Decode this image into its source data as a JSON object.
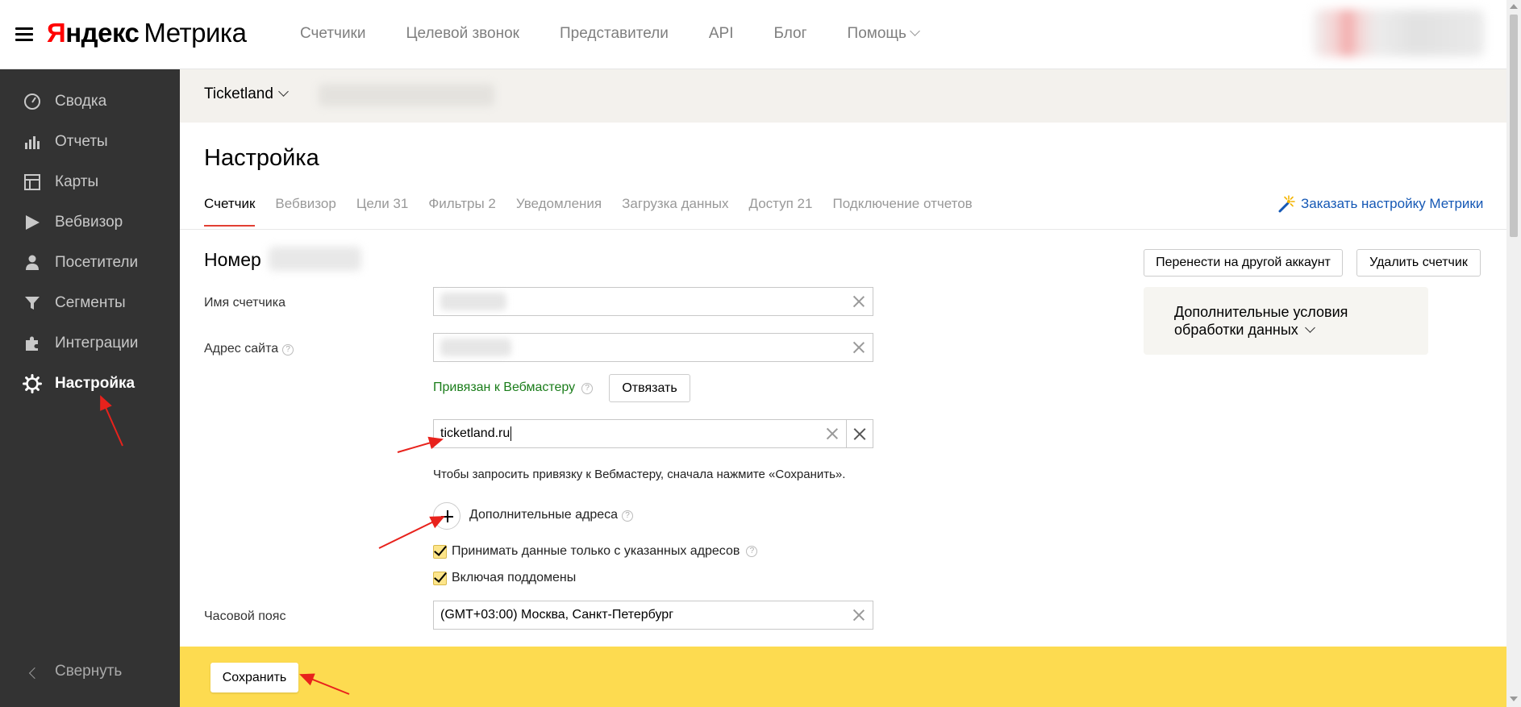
{
  "brand": {
    "logo_ya": "Я",
    "logo_ya_rest": "ндекс",
    "product": "Метрика"
  },
  "topnav": {
    "items": [
      {
        "label": "Счетчики"
      },
      {
        "label": "Целевой звонок"
      },
      {
        "label": "Представители"
      },
      {
        "label": "API"
      },
      {
        "label": "Блог"
      },
      {
        "label": "Помощь"
      }
    ]
  },
  "sidebar": {
    "items": [
      {
        "label": "Сводка",
        "icon": "dashboard-icon"
      },
      {
        "label": "Отчеты",
        "icon": "bar-chart-icon"
      },
      {
        "label": "Карты",
        "icon": "map-layout-icon"
      },
      {
        "label": "Вебвизор",
        "icon": "play-icon"
      },
      {
        "label": "Посетители",
        "icon": "user-icon"
      },
      {
        "label": "Сегменты",
        "icon": "filter-icon"
      },
      {
        "label": "Интеграции",
        "icon": "puzzle-icon"
      },
      {
        "label": "Настройка",
        "icon": "gear-icon",
        "active": true
      }
    ],
    "collapse_label": "Свернуть"
  },
  "counter": {
    "name": "Ticketland"
  },
  "page": {
    "title": "Настройка",
    "tabs": [
      {
        "label": "Счетчик",
        "active": true
      },
      {
        "label": "Вебвизор"
      },
      {
        "label": "Цели 31"
      },
      {
        "label": "Фильтры 2"
      },
      {
        "label": "Уведомления"
      },
      {
        "label": "Загрузка данных"
      },
      {
        "label": "Доступ 21"
      },
      {
        "label": "Подключение отчетов"
      }
    ],
    "order_link": "Заказать настройку Метрики"
  },
  "form": {
    "number_title": "Номер",
    "name_label": "Имя счетчика",
    "site_label": "Адрес сайта",
    "webmaster_link": "Привязан к Вебмастеру",
    "unlink_button": "Отвязать",
    "mirror_value": "ticketland.ru",
    "hint": "Чтобы запросить привязку к Вебмастеру, сначала нажмите «Сохранить».",
    "extra_addresses": "Дополнительные адреса",
    "accept_only": "Принимать данные только с указанных адресов",
    "include_subdomains": "Включая поддомены",
    "timezone_label": "Часовой пояс",
    "timezone_value": "(GMT+03:00) Москва, Санкт-Петербург",
    "help_glyph": "?"
  },
  "actions": {
    "move_account": "Перенести на другой аккаунт",
    "delete_counter": "Удалить счетчик",
    "extra_conditions_line1": "Дополнительные условия",
    "extra_conditions_line2": "обработки данных"
  },
  "savebar": {
    "save_label": "Сохранить"
  },
  "colors": {
    "sidebar_bg": "#333333",
    "accent_red": "#e23f33",
    "link_blue": "#1558b5",
    "link_green": "#1a7d1a",
    "save_bar_yellow": "#fddb50",
    "annotation_red": "#e8221c"
  }
}
